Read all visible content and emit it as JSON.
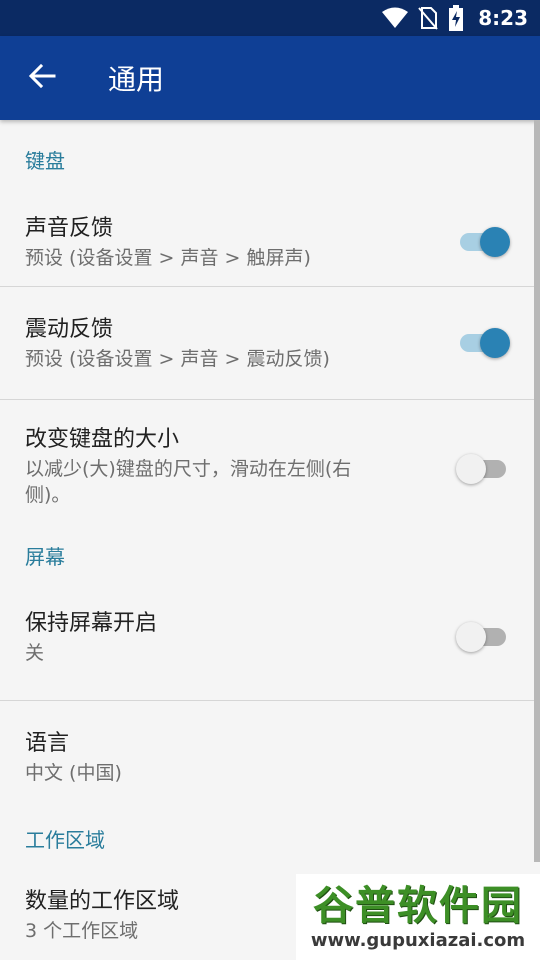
{
  "status_bar": {
    "time": "8:23",
    "icons": [
      "wifi-icon",
      "no-sim-icon",
      "battery-charging-icon"
    ]
  },
  "app_bar": {
    "title": "通用",
    "back_icon": "arrow-back-icon",
    "color": "#0f3f95"
  },
  "sections": {
    "keyboard": {
      "header": "键盘",
      "sound_feedback": {
        "title": "声音反馈",
        "summary": "预设 (设备设置 > 声音 > 触屏声)",
        "enabled": true
      },
      "vibration_feedback": {
        "title": "震动反馈",
        "summary": "预设 (设备设置 > 声音 > 震动反馈)",
        "enabled": true
      },
      "keyboard_size": {
        "title": "改变键盘的大小",
        "summary": "以减少(大)键盘的尺寸，滑动在左侧(右侧)。",
        "enabled": false
      }
    },
    "screen": {
      "header": "屏幕",
      "keep_screen_on": {
        "title": "保持屏幕开启",
        "summary": "关",
        "enabled": false
      },
      "language": {
        "title": "语言",
        "summary": "中文 (中国)"
      }
    },
    "workspace": {
      "header": "工作区域",
      "workspace_count": {
        "title": "数量的工作区域",
        "summary": "3 个工作区域"
      }
    }
  },
  "watermark": {
    "name": "谷普软件园",
    "url": "www.gupuxiazai.com"
  },
  "colors": {
    "accent": "#2a82b4",
    "section_header": "#2a7d9c",
    "status_bar": "#0b2a63"
  }
}
